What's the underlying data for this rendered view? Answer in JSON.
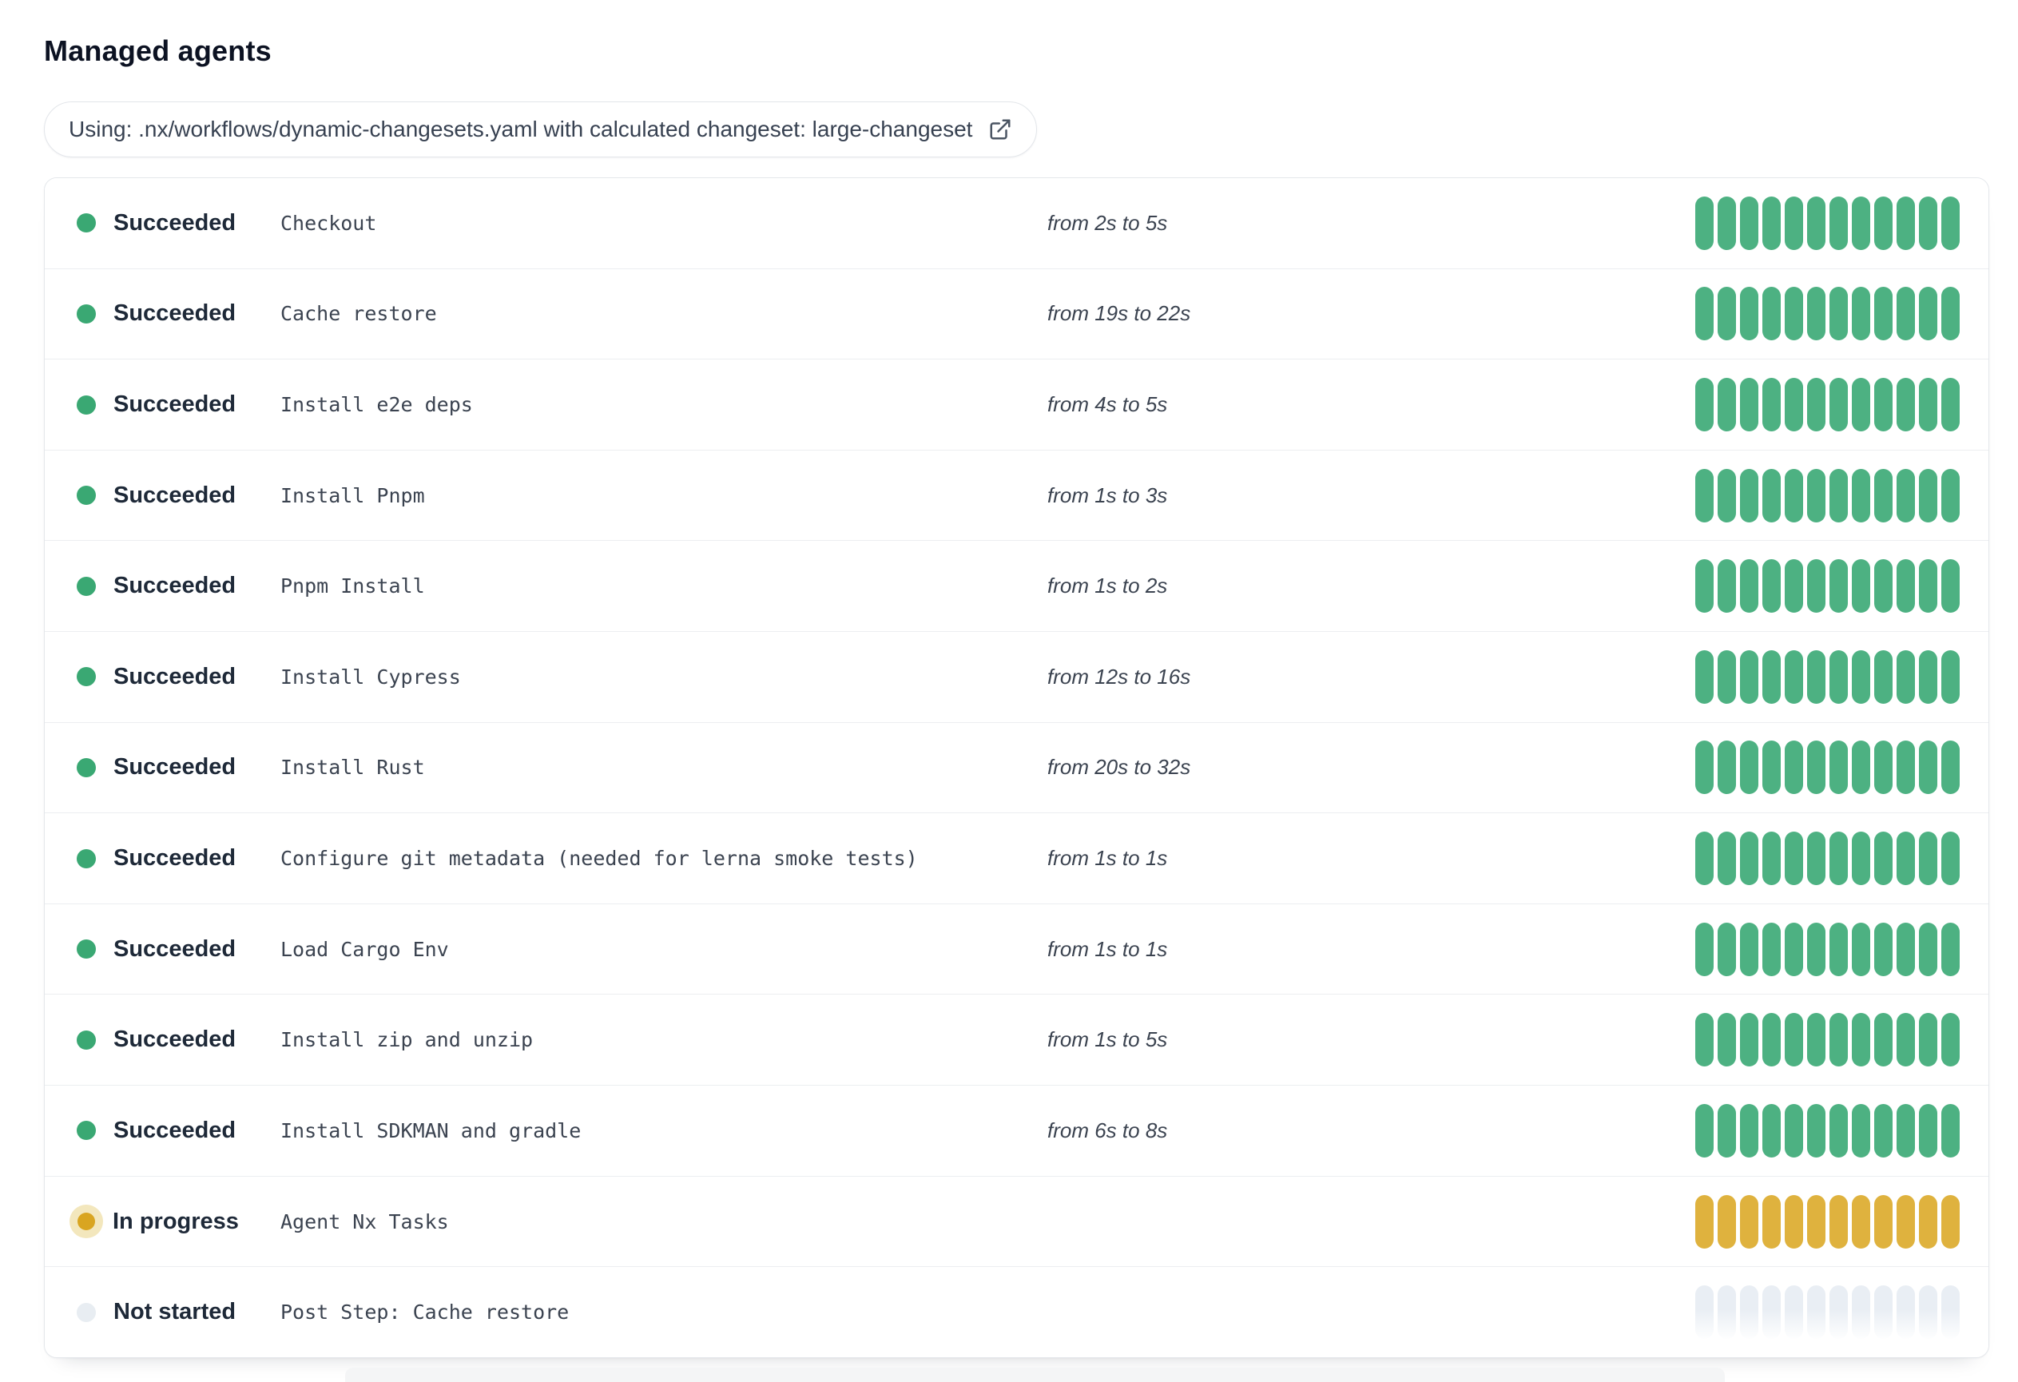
{
  "page": {
    "title": "Managed agents"
  },
  "banner": {
    "text": "Using: .nx/workflows/dynamic-changesets.yaml with calculated changeset: large-changeset",
    "icon": "external-link-icon"
  },
  "bars_per_row": 12,
  "colors": {
    "title_text": "#0c1222",
    "pill_text": "#374151",
    "pill_border": "#e3e6ea",
    "card_border": "#e4e7eb",
    "row_divider": "#eceef1",
    "status_text": "#1e2938",
    "step_text": "#3b4350",
    "succeeded_dot": "#3aa873",
    "succeeded_bar": "#4db182",
    "in_progress_dot": "#d9a521",
    "in_progress_halo": "#f3e7bd",
    "in_progress_bar": "#dfb23e",
    "not_started_dot": "#e8edf2",
    "not_started_bar": "#e9eef4"
  },
  "agents": [
    {
      "state": "succeeded",
      "status": "Succeeded",
      "step": "Checkout",
      "duration": "from 2s to 5s"
    },
    {
      "state": "succeeded",
      "status": "Succeeded",
      "step": "Cache restore",
      "duration": "from 19s to 22s"
    },
    {
      "state": "succeeded",
      "status": "Succeeded",
      "step": "Install e2e deps",
      "duration": "from 4s to 5s"
    },
    {
      "state": "succeeded",
      "status": "Succeeded",
      "step": "Install Pnpm",
      "duration": "from 1s to 3s"
    },
    {
      "state": "succeeded",
      "status": "Succeeded",
      "step": "Pnpm Install",
      "duration": "from 1s to 2s"
    },
    {
      "state": "succeeded",
      "status": "Succeeded",
      "step": "Install Cypress",
      "duration": "from 12s to 16s"
    },
    {
      "state": "succeeded",
      "status": "Succeeded",
      "step": "Install Rust",
      "duration": "from 20s to 32s"
    },
    {
      "state": "succeeded",
      "status": "Succeeded",
      "step": "Configure git metadata (needed for lerna smoke tests)",
      "duration": "from 1s to 1s"
    },
    {
      "state": "succeeded",
      "status": "Succeeded",
      "step": "Load Cargo Env",
      "duration": "from 1s to 1s"
    },
    {
      "state": "succeeded",
      "status": "Succeeded",
      "step": "Install zip and unzip",
      "duration": "from 1s to 5s"
    },
    {
      "state": "succeeded",
      "status": "Succeeded",
      "step": "Install SDKMAN and gradle",
      "duration": "from 6s to 8s"
    },
    {
      "state": "in-progress",
      "status": "In progress",
      "step": "Agent Nx Tasks",
      "duration": ""
    },
    {
      "state": "not-started",
      "status": "Not started",
      "step": "Post Step: Cache restore",
      "duration": ""
    }
  ]
}
